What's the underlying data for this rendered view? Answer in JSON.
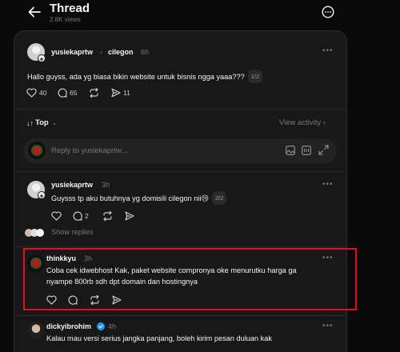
{
  "header": {
    "title": "Thread",
    "views": "2.8K views"
  },
  "main_post": {
    "username": "yusiekaprtw",
    "reply_to": "cilegon",
    "time": "6h",
    "text": "Hallo guyss, ada yg biasa bikin website untuk bisnis ngga yaaa???",
    "page_badge": "1/2",
    "likes": "40",
    "comments": "65",
    "shares": "11"
  },
  "sort": {
    "label": "Top",
    "view_activity": "View activity"
  },
  "reply_box": {
    "placeholder": "Reply to yusiekaprtw..."
  },
  "replies": [
    {
      "username": "yusiekaprtw",
      "time": "3h",
      "text": "Guysss tp aku butuhnya yg domisili cilegon nii😢",
      "page_badge": "2/2",
      "comments": "2",
      "show_replies": "Show replies"
    },
    {
      "username": "thinkkyu",
      "time": "3h",
      "text_line1": "Coba cek idwebhost Kak, paket website compronya oke menurutku harga ga",
      "text_line2": "nyampe 800rb sdh dpt domain dan hostingnya"
    },
    {
      "username": "dickyibrohim",
      "time": "4h",
      "text": "Kalau mau versi serius jangka panjang, boleh kirim pesan duluan kak"
    }
  ],
  "colors": {
    "background": "#0a0a0a",
    "panel": "#181818",
    "highlight": "#e3101c",
    "verified": "#1d9bf0"
  }
}
